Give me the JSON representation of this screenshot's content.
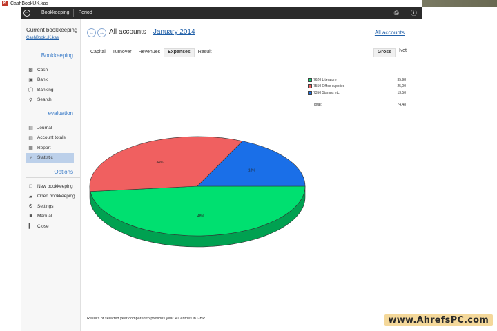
{
  "window": {
    "title": "CashBookUK.kas"
  },
  "menubar": {
    "items": [
      "Bookkeeping",
      "Period"
    ]
  },
  "sidebar": {
    "current_title": "Current bookkeeping",
    "current_file": "CashBookUK.kas",
    "sections": [
      {
        "title": "Bookkeeping",
        "items": [
          {
            "label": "Cash",
            "icon": "cash-register-icon"
          },
          {
            "label": "Bank",
            "icon": "bank-icon"
          },
          {
            "label": "Banking",
            "icon": "globe-icon"
          },
          {
            "label": "Search",
            "icon": "search-icon"
          }
        ]
      },
      {
        "title": "evaluation",
        "items": [
          {
            "label": "Journal",
            "icon": "journal-icon"
          },
          {
            "label": "Account totals",
            "icon": "account-totals-icon"
          },
          {
            "label": "Report",
            "icon": "report-icon"
          },
          {
            "label": "Statistic",
            "icon": "statistic-icon",
            "active": true
          }
        ]
      },
      {
        "title": "Options",
        "items": [
          {
            "label": "New bookkeeping",
            "icon": "new-file-icon"
          },
          {
            "label": "Open bookkeeping",
            "icon": "open-folder-icon"
          },
          {
            "label": "Settings",
            "icon": "gear-icon"
          },
          {
            "label": "Manual",
            "icon": "book-icon"
          },
          {
            "label": "Close",
            "icon": "close-door-icon"
          }
        ]
      }
    ]
  },
  "main": {
    "title": "All accounts",
    "period": "January 2014",
    "all_accounts_link": "All accounts",
    "tabs": [
      "Capital",
      "Turnover",
      "Revenues",
      "Expenses",
      "Result"
    ],
    "active_tab": "Expenses",
    "right_tabs": [
      "Gross",
      "Net"
    ],
    "active_right_tab": "Gross",
    "footer": "Results of selected year compared to previous year. All entries in GBP"
  },
  "chart_data": {
    "type": "pie",
    "slices": [
      {
        "label": "7620 Literature",
        "value": 35.98,
        "percent_label": "48%",
        "color": "#00e070"
      },
      {
        "label": "7550 Office supplies",
        "value": 25.0,
        "percent_label": "34%",
        "color": "#f06060"
      },
      {
        "label": "7350 Stamps etc.",
        "value": 13.5,
        "percent_label": "18%",
        "color": "#1a6fe8"
      }
    ],
    "legend_values": [
      "35,98",
      "25,00",
      "13,50"
    ],
    "total_label": "Total:",
    "total_value": "74,48"
  },
  "watermark": "www.AhrefsPC.com"
}
